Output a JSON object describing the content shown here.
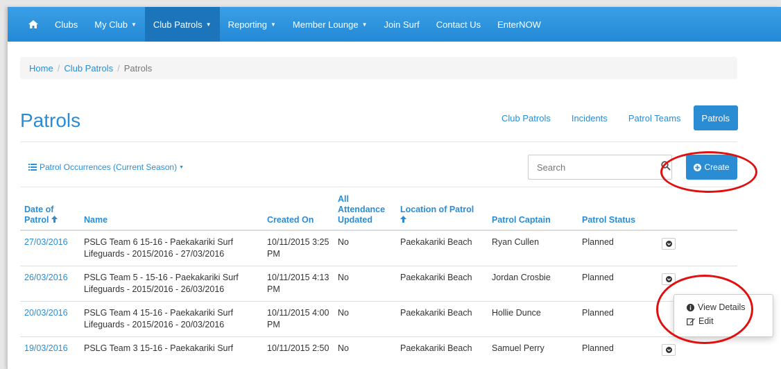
{
  "nav": {
    "items": [
      {
        "label": "Clubs",
        "caret": false,
        "active": false
      },
      {
        "label": "My Club",
        "caret": true,
        "active": false
      },
      {
        "label": "Club Patrols",
        "caret": true,
        "active": true
      },
      {
        "label": "Reporting",
        "caret": true,
        "active": false
      },
      {
        "label": "Member Lounge",
        "caret": true,
        "active": false
      },
      {
        "label": "Join Surf",
        "caret": false,
        "active": false
      },
      {
        "label": "Contact Us",
        "caret": false,
        "active": false
      },
      {
        "label": "EnterNOW",
        "caret": false,
        "active": false
      }
    ]
  },
  "breadcrumb": {
    "home": "Home",
    "club_patrols": "Club Patrols",
    "current": "Patrols",
    "separator": "/"
  },
  "page": {
    "title": "Patrols"
  },
  "tabs": [
    {
      "label": "Club Patrols",
      "active": false
    },
    {
      "label": "Incidents",
      "active": false
    },
    {
      "label": "Patrol Teams",
      "active": false
    },
    {
      "label": "Patrols",
      "active": true
    }
  ],
  "toolbar": {
    "view_label": "Patrol Occurrences (Current Season)",
    "search_placeholder": "Search",
    "create_label": "Create"
  },
  "table": {
    "headers": {
      "date": [
        "Date of",
        "Patrol"
      ],
      "name": "Name",
      "created": "Created On",
      "attendance": [
        "All",
        "Attendance",
        "Updated"
      ],
      "location": [
        "Location of Patrol"
      ],
      "captain": "Patrol Captain",
      "status": "Patrol Status"
    },
    "rows": [
      {
        "date": "27/03/2016",
        "name": "PSLG Team 6 15-16 - Paekakariki Surf Lifeguards - 2015/2016 - 27/03/2016",
        "created": "10/11/2015 3:25 PM",
        "attendance": "No",
        "location": "Paekakariki Beach",
        "captain": "Ryan Cullen",
        "status": "Planned"
      },
      {
        "date": "26/03/2016",
        "name": "PSLG Team 5 - 15-16 - Paekakariki Surf Lifeguards - 2015/2016 - 26/03/2016",
        "created": "10/11/2015 4:13 PM",
        "attendance": "No",
        "location": "Paekakariki Beach",
        "captain": "Jordan Crosbie",
        "status": "Planned"
      },
      {
        "date": "20/03/2016",
        "name": "PSLG Team 4 15-16 - Paekakariki Surf Lifeguards - 2015/2016 - 20/03/2016",
        "created": "10/11/2015 4:00 PM",
        "attendance": "No",
        "location": "Paekakariki Beach",
        "captain": "Hollie Dunce",
        "status": "Planned"
      },
      {
        "date": "19/03/2016",
        "name": "PSLG Team 3 15-16 - Paekakariki Surf",
        "created": "10/11/2015 2:50",
        "attendance": "No",
        "location": "Paekakariki Beach",
        "captain": "Samuel Perry",
        "status": "Planned"
      }
    ]
  },
  "row_menu": {
    "view_details": "View Details",
    "edit": "Edit"
  },
  "colors": {
    "primary": "#2a8dd4",
    "nav_top": "#3a9fe5",
    "nav_active": "#1c75bb",
    "annotation": "#e01010"
  },
  "icons": [
    "home-icon",
    "list-icon",
    "search-icon",
    "plus-circle-icon",
    "sort-up-arrow-icon",
    "chevron-down-circle-icon",
    "info-circle-icon",
    "edit-icon"
  ]
}
